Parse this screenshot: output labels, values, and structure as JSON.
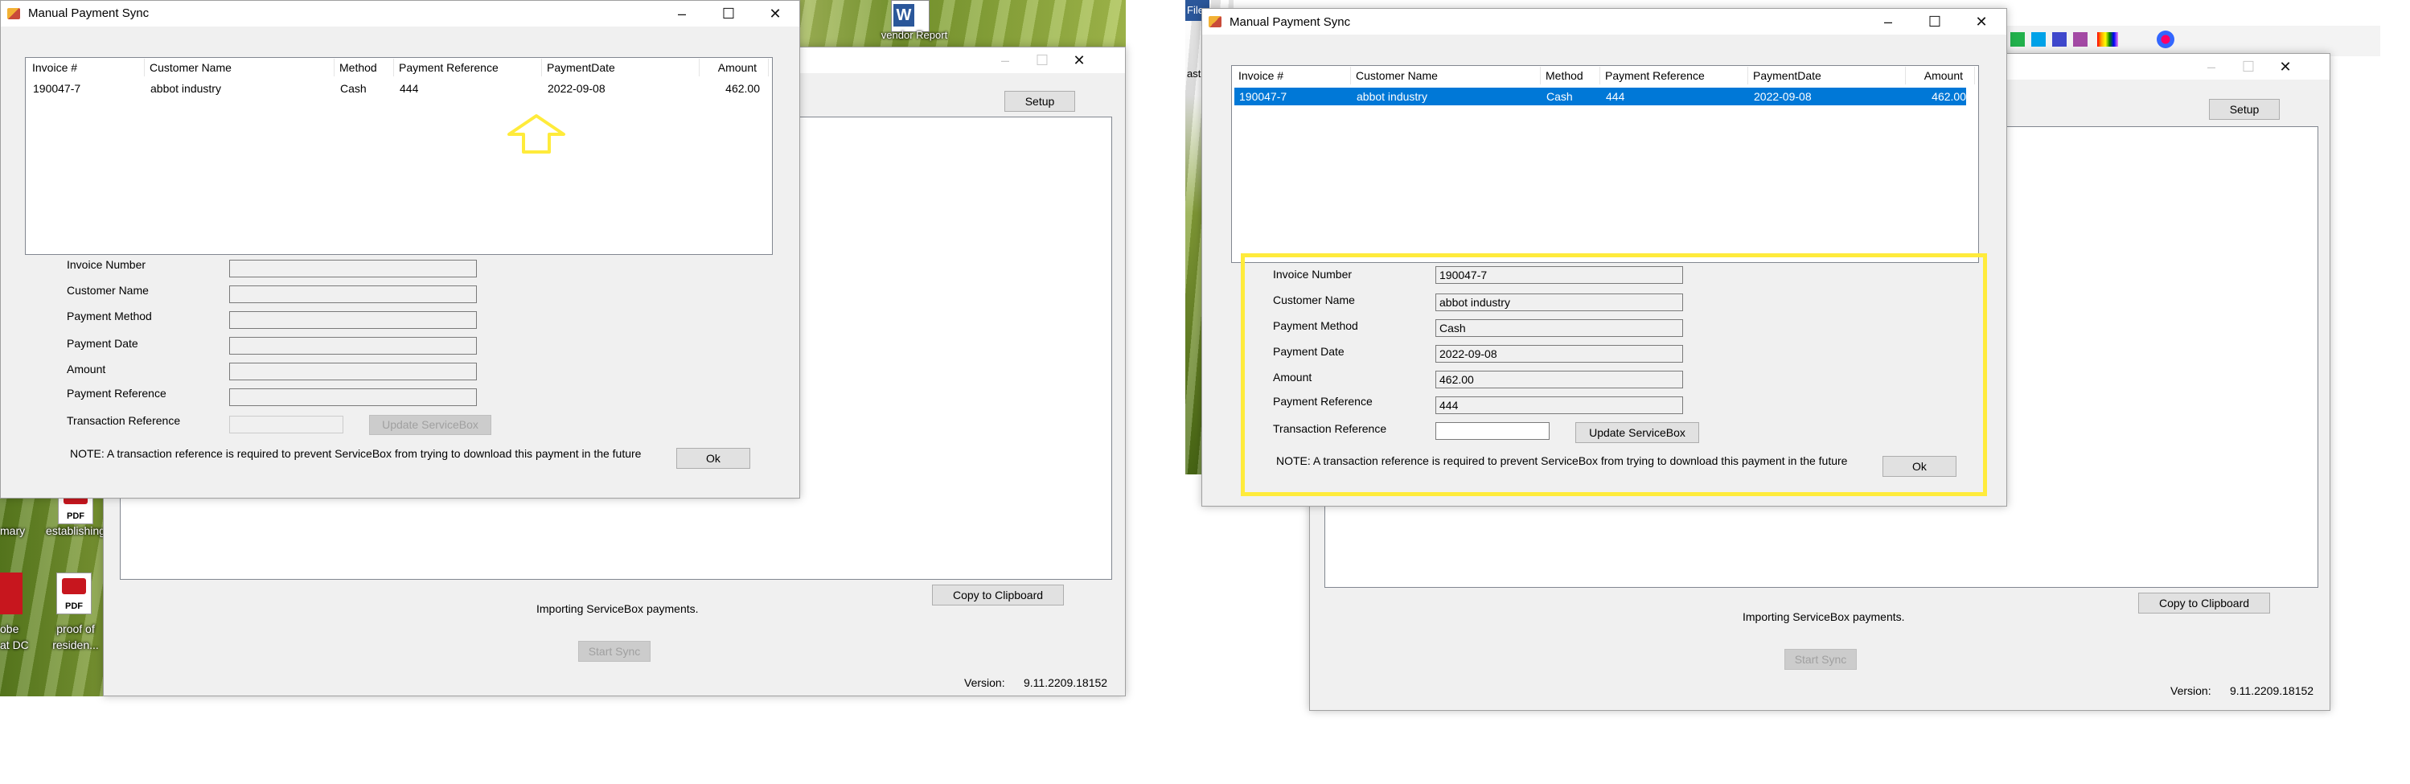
{
  "manual_dialog": {
    "title": "Manual Payment Sync",
    "columns": [
      "Invoice #",
      "Customer Name",
      "Method",
      "Payment Reference",
      "PaymentDate",
      "Amount"
    ],
    "rows": [
      [
        "190047-7",
        "abbot  industry",
        "Cash",
        "444",
        "2022-09-08",
        "462.00"
      ]
    ],
    "labels": {
      "invoice_number": "Invoice Number",
      "customer_name": "Customer Name",
      "payment_method": "Payment Method",
      "payment_date": "Payment Date",
      "amount": "Amount",
      "payment_reference": "Payment Reference",
      "transaction_reference": "Transaction Reference"
    },
    "update_button": "Update ServiceBox",
    "note": "NOTE: A transaction reference is required to prevent ServiceBox from trying to download this payment in the future",
    "ok_button": "Ok"
  },
  "filled_values": {
    "invoice_number": "190047-7",
    "customer_name": "abbot  industry",
    "payment_method": "Cash",
    "payment_date": "2022-09-08",
    "amount": "462.00",
    "payment_reference": "444"
  },
  "main_window": {
    "setup_button": "Setup",
    "copy_button": "Copy to Clipboard",
    "status_text": "Importing ServiceBox payments.",
    "start_button": "Start Sync",
    "version_label": "Version:",
    "version_value": "9.11.2209.18152"
  },
  "desktop": {
    "word_label": "vendor Report",
    "pdf_badge": "PDF",
    "icon1_label": "establishing",
    "icon2_label_line1": "proof of",
    "icon2_label_line2": "residen...",
    "left_edge_1": "mary",
    "left_edge_2": "obe",
    "left_edge_3": "at DC",
    "background_app_letters": [
      "File",
      "aste"
    ]
  },
  "colors": {
    "selection": "#0078d7",
    "highlight": "#ffeb3b",
    "window_bg": "#f0f0f0"
  },
  "icons": {
    "minimize": "minimize-icon",
    "maximize": "maximize-icon",
    "close": "close-icon",
    "arrow": "up-arrow-annotation-icon"
  }
}
